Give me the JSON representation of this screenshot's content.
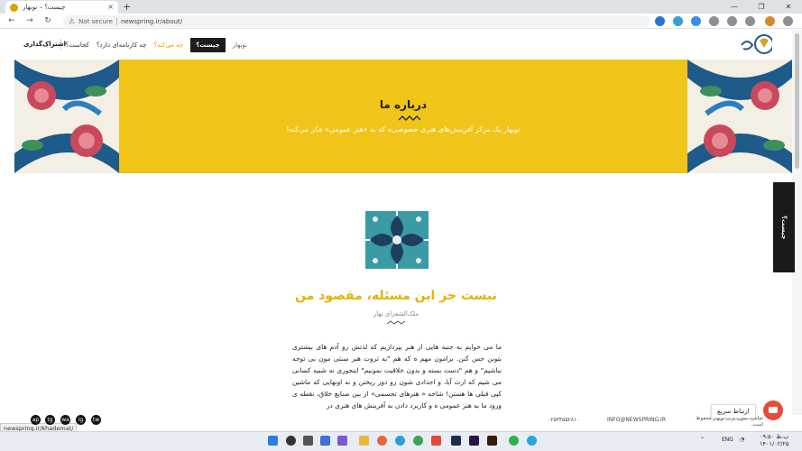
{
  "browser": {
    "tab_title": "چیست؟ – نوبهار",
    "close_glyph": "×",
    "new_tab_glyph": "+",
    "security_label": "Not secure",
    "url": "newspring.ir/about/",
    "window_controls": [
      "—",
      "❐",
      "✕"
    ],
    "nav_glyphs": [
      "←",
      "→",
      "↻"
    ]
  },
  "site": {
    "nav": {
      "brand": "نوبهار",
      "active": "چیست؟",
      "what": "چه می‌کند؟",
      "workshops": "چه کارنامه‌ای دارد؟",
      "where": "کجاست؟"
    },
    "signup": "اشتراک‌گذاری"
  },
  "hero": {
    "title": "درباره ما",
    "subtitle": "نوبهار یک مرکز آفرینش‌های هنری خصوصی‌ه که به «هنر عمومی» فکر می‌کنه!"
  },
  "main": {
    "title": "نیست جز این مسئله، مقصود من",
    "poet": "ملک‌الشعرای بهار",
    "body": "ما می خوایم به جنبه هایی از هنر بپردازیم که لذتش رو آدم های بیشتری بتونن حس کنن. برامون مهم ه که هم \"به ثروت هنر سنتی مون بی توجه نباشیم\" و هم \"دست بسته و بدون خلاقیت نمونیم\" اینجوری نه شبیه کسانی می شیم که ارث آبا، و اجدادی شون رو دور ریختن و نه اونهایی که ماشین کپی قبلی ها هستن! شاخه « هنرهای تجسمی» از بین صنایع خلاق، نقطه ی ورود ما به هنر عمومی ه و کاربرد دادن به آفرینش های هنری در",
    "side_tab": "چیست؟"
  },
  "footer": {
    "status_url": "newspring.ir/khademat/",
    "phone": "۰۲۵۳۳۵۵۲۸۱۰",
    "email": "INFO@NEWSPRING.IR",
    "copyright": "تمامی حقوق برای نوبهار محفوظ است.",
    "quick_contact": "ارتباط سریع",
    "social": [
      "tw",
      "ig",
      "wa",
      "tg",
      "ap"
    ]
  },
  "taskbar": {
    "lang": "ENG",
    "time": "۰۹:۵۰ ب.ظ",
    "date": "۱۴۰۱/۰۲/۲۵"
  },
  "colors": {
    "accent_yellow": "#f0c418",
    "title_gold": "#e0b500",
    "nav_orange": "#e0a100",
    "dark": "#1c1c1c",
    "quick_red": "#e64b3c"
  }
}
